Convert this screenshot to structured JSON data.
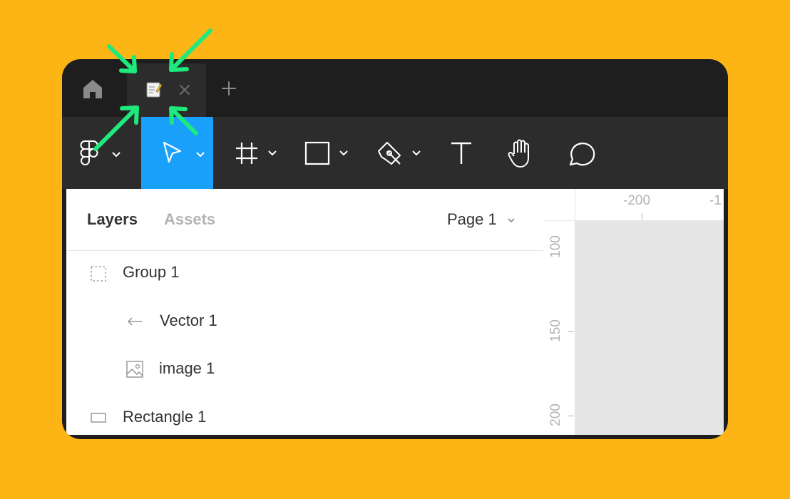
{
  "colors": {
    "background": "#FDB515",
    "window": "#1e1e1e",
    "toolbar": "#2c2c2c",
    "active_tool": "#18a0fb",
    "annotation_arrows": "#1de97d"
  },
  "tabbar": {
    "home_icon": "home-icon",
    "file_tab_icon": "file-edit-icon",
    "close_icon": "close-icon",
    "new_tab_icon": "plus-icon"
  },
  "toolbar": {
    "tools": [
      {
        "icon": "figma-logo-icon",
        "has_menu": true
      },
      {
        "icon": "move-cursor-icon",
        "has_menu": true,
        "active": true
      },
      {
        "icon": "frame-icon",
        "has_menu": true
      },
      {
        "icon": "rectangle-icon",
        "has_menu": true
      },
      {
        "icon": "pen-icon",
        "has_menu": true
      },
      {
        "icon": "text-icon",
        "has_menu": false
      },
      {
        "icon": "hand-icon",
        "has_menu": false
      },
      {
        "icon": "comment-icon",
        "has_menu": false
      }
    ]
  },
  "panel": {
    "tabs": {
      "layers": "Layers",
      "assets": "Assets"
    },
    "page_selector": "Page 1"
  },
  "layers": [
    {
      "name": "Group 1",
      "icon": "group-icon"
    },
    {
      "name": "Vector 1",
      "icon": "vector-arrow-icon"
    },
    {
      "name": "image 1",
      "icon": "image-icon"
    },
    {
      "name": "Rectangle 1",
      "icon": "rectangle-layer-icon"
    }
  ],
  "rulers": {
    "top": [
      "-200",
      "-1"
    ],
    "left": [
      "100",
      "150",
      "200"
    ]
  }
}
